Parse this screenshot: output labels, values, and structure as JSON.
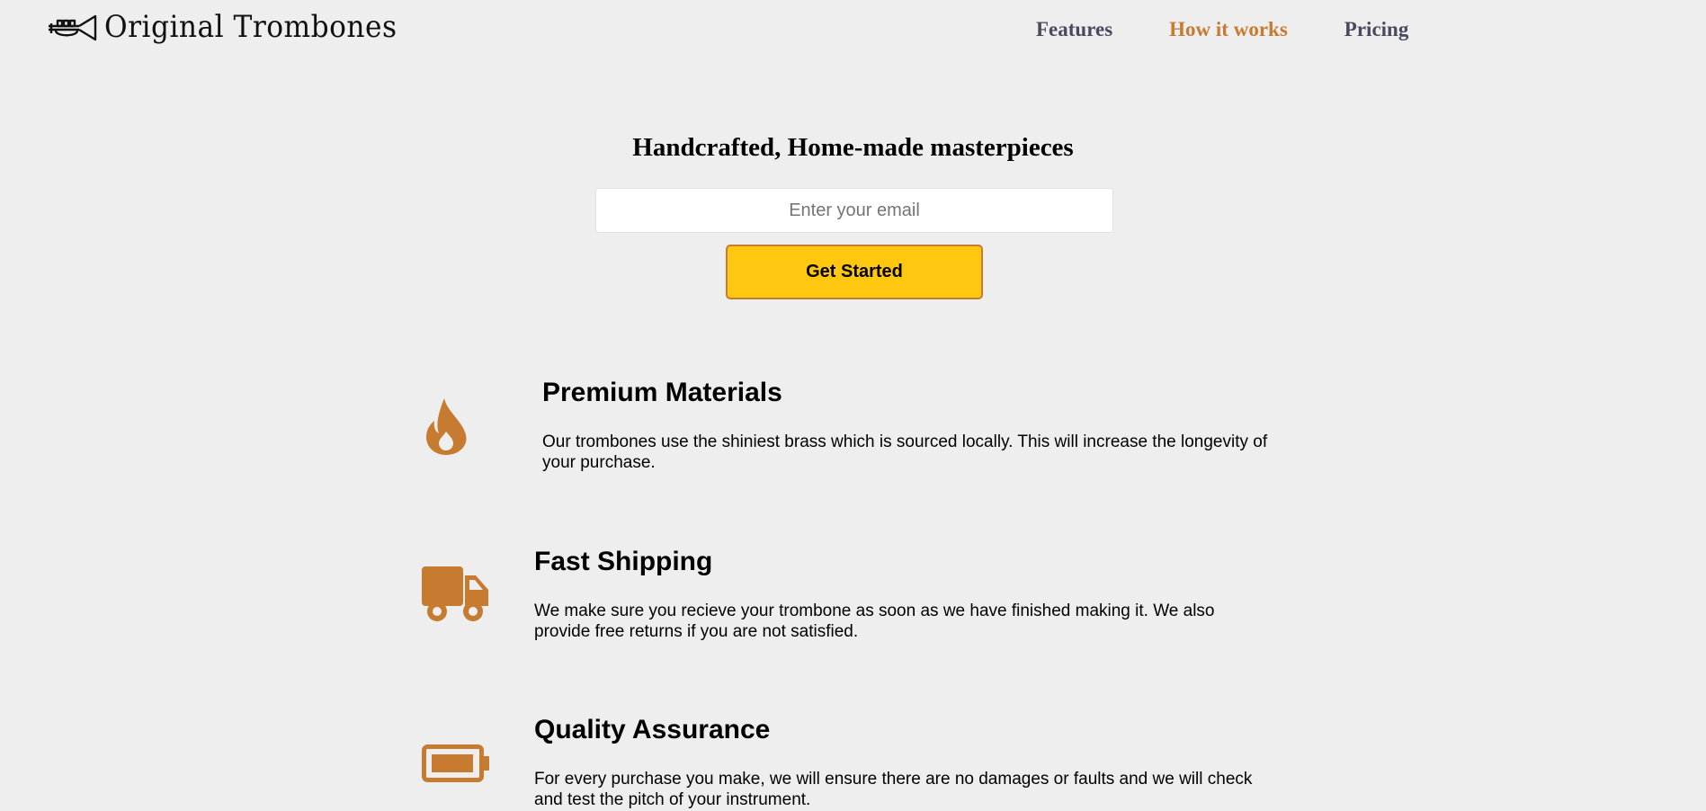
{
  "header": {
    "brand": "Original Trombones",
    "logo_icon": "trumpet-icon",
    "nav": [
      {
        "label": "Features"
      },
      {
        "label": "How it works"
      },
      {
        "label": "Pricing"
      }
    ],
    "active_nav": "How it works"
  },
  "hero": {
    "title": "Handcrafted, Home-made masterpieces",
    "email_placeholder": "Enter your email",
    "email_value": "",
    "button_label": "Get Started"
  },
  "features": [
    {
      "icon": "fire-icon",
      "title": "Premium Materials",
      "description": "Our trombones use the shiniest brass which is sourced locally. This will increase the longevity of your purchase."
    },
    {
      "icon": "truck-icon",
      "title": "Fast Shipping",
      "description": "We make sure you recieve your trombone as soon as we have finished making it. We also provide free returns if you are not satisfied."
    },
    {
      "icon": "battery-icon",
      "title": "Quality Assurance",
      "description": "For every purchase you make, we will ensure there are no damages or faults and we will check and test the pitch of your instrument."
    }
  ],
  "colors": {
    "background": "#eeeeee",
    "accent": "#c77b30",
    "button": "#ffc70f",
    "nav_text": "#4a4a5e"
  }
}
